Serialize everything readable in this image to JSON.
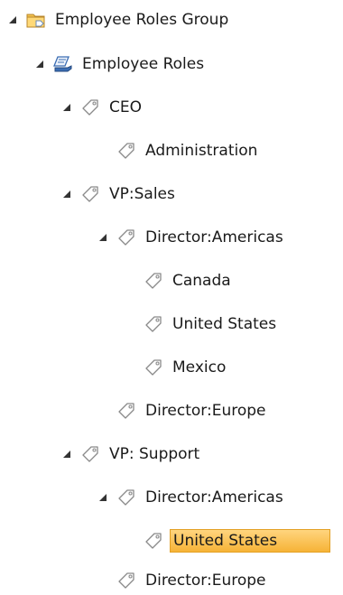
{
  "tree": {
    "root": {
      "label": "Employee Roles Group",
      "icon": "folder-group-icon"
    },
    "roles": {
      "label": "Employee Roles",
      "icon": "roles-stack-icon"
    },
    "ceo": {
      "label": "CEO",
      "icon": "tag-icon"
    },
    "ceo_admin": {
      "label": "Administration",
      "icon": "tag-icon"
    },
    "vp_sales": {
      "label": "VP:Sales",
      "icon": "tag-icon"
    },
    "sales_dir_americas": {
      "label": "Director:Americas",
      "icon": "tag-icon"
    },
    "sales_canada": {
      "label": "Canada",
      "icon": "tag-icon"
    },
    "sales_us": {
      "label": "United States",
      "icon": "tag-icon"
    },
    "sales_mexico": {
      "label": "Mexico",
      "icon": "tag-icon"
    },
    "sales_dir_europe": {
      "label": "Director:Europe",
      "icon": "tag-icon"
    },
    "vp_support": {
      "label": "VP: Support",
      "icon": "tag-icon"
    },
    "support_dir_americas": {
      "label": "Director:Americas",
      "icon": "tag-icon"
    },
    "support_us": {
      "label": "United States",
      "icon": "tag-icon",
      "selected": true
    },
    "support_dir_europe": {
      "label": "Director:Europe",
      "icon": "tag-icon"
    }
  },
  "colors": {
    "selection_fill": "#f6b337",
    "selection_border": "#e3a024",
    "tag_outline": "#8a8a8a",
    "folder": "#f2c14e",
    "roles_icon": "#3b6db3"
  }
}
